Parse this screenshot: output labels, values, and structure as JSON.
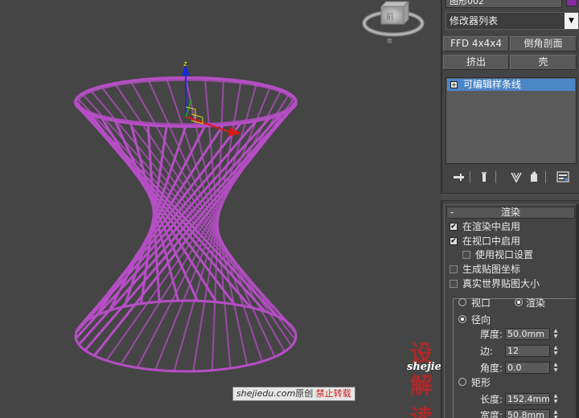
{
  "command_panel": {
    "object_name": "图形002",
    "object_color": "#8a2aa8",
    "modifier_list_label": "修改器列表",
    "quick_buttons": [
      "FFD 4x4x4",
      "倒角剖面",
      "挤出",
      "壳"
    ],
    "stack_item": "可编辑样条线",
    "stack_tools": [
      "pin-stack-icon",
      "show-end-result-icon",
      "make-unique-icon",
      "remove-modifier-icon",
      "configure-modifier-sets-icon"
    ]
  },
  "rendering_rollout": {
    "title": "渲染",
    "collapse_symbol": "-",
    "enable_in_renderer": {
      "label": "在渲染中启用",
      "checked": true
    },
    "enable_in_viewport": {
      "label": "在视口中启用",
      "checked": true
    },
    "use_viewport_settings": {
      "label": "使用视口设置",
      "checked": false
    },
    "generate_mapping_coords": {
      "label": "生成贴图坐标",
      "checked": false
    },
    "real_world_map_size": {
      "label": "真实世界贴图大小",
      "checked": false
    },
    "mode_viewport": {
      "label": "视口",
      "selected": false
    },
    "mode_render": {
      "label": "渲染",
      "selected": true
    },
    "radial": {
      "label": "径向",
      "selected": true
    },
    "thickness": {
      "label": "厚度:",
      "value": "50.0mm"
    },
    "sides": {
      "label": "边:",
      "value": "12"
    },
    "angle": {
      "label": "角度:",
      "value": "0.0"
    },
    "rectangular": {
      "label": "矩形",
      "selected": false
    },
    "length": {
      "label": "长度:",
      "value": "152.4mm"
    },
    "width": {
      "label": "宽度:",
      "value": "50.8mm"
    }
  },
  "viewport": {
    "viewcube_face": "前",
    "gizmo_axis_label": "z",
    "wire_color": "#b54ec4"
  },
  "watermark": {
    "logo_text": "设解读",
    "site_url": "shejiedu.com",
    "caption_url": "shejiedu.com",
    "caption_text": "原创",
    "caption_warning": "禁止转载"
  }
}
